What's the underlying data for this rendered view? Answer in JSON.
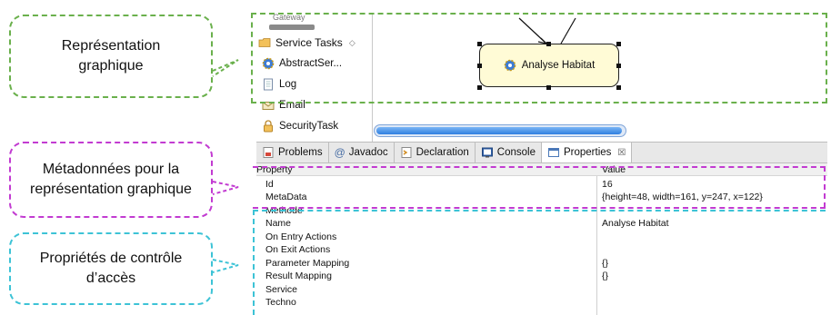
{
  "callouts": {
    "graphic": [
      "Représentation",
      "graphique"
    ],
    "metadata": [
      "Métadonnées pour la",
      "représentation graphique"
    ],
    "access": [
      "Propriétés de contrôle",
      "d’accès"
    ]
  },
  "palette": {
    "gateway_label": "Gateway",
    "group_label": "Service Tasks",
    "group_toggle": "◇",
    "items": [
      "AbstractSer...",
      "Log",
      "Email",
      "SecurityTask"
    ]
  },
  "canvas": {
    "task_label": "Analyse Habitat"
  },
  "tabs": [
    {
      "label": "Problems",
      "icon": "problems-icon"
    },
    {
      "label": "Javadoc",
      "icon": "at-icon"
    },
    {
      "label": "Declaration",
      "icon": "declaration-icon"
    },
    {
      "label": "Console",
      "icon": "console-icon"
    },
    {
      "label": "Properties",
      "icon": "properties-icon",
      "active": true,
      "close": "☒"
    }
  ],
  "properties": {
    "header": {
      "key": "Property",
      "value": "Value"
    },
    "rows": [
      {
        "key": "Id",
        "value": "16"
      },
      {
        "key": "MetaData",
        "value": "{height=48, width=161, y=247, x=122}"
      },
      {
        "key": "Methode",
        "value": ""
      },
      {
        "key": "Name",
        "value": "Analyse Habitat"
      },
      {
        "key": "On Entry Actions",
        "value": ""
      },
      {
        "key": "On Exit Actions",
        "value": ""
      },
      {
        "key": "Parameter Mapping",
        "value": "{}"
      },
      {
        "key": "Result Mapping",
        "value": "{}"
      },
      {
        "key": "Service",
        "value": ""
      },
      {
        "key": "Techno",
        "value": ""
      }
    ]
  },
  "colors": {
    "green": "#6ab04c",
    "magenta": "#c23bd1",
    "cyan": "#3dc3d6",
    "task_fill": "#fffbd6"
  }
}
